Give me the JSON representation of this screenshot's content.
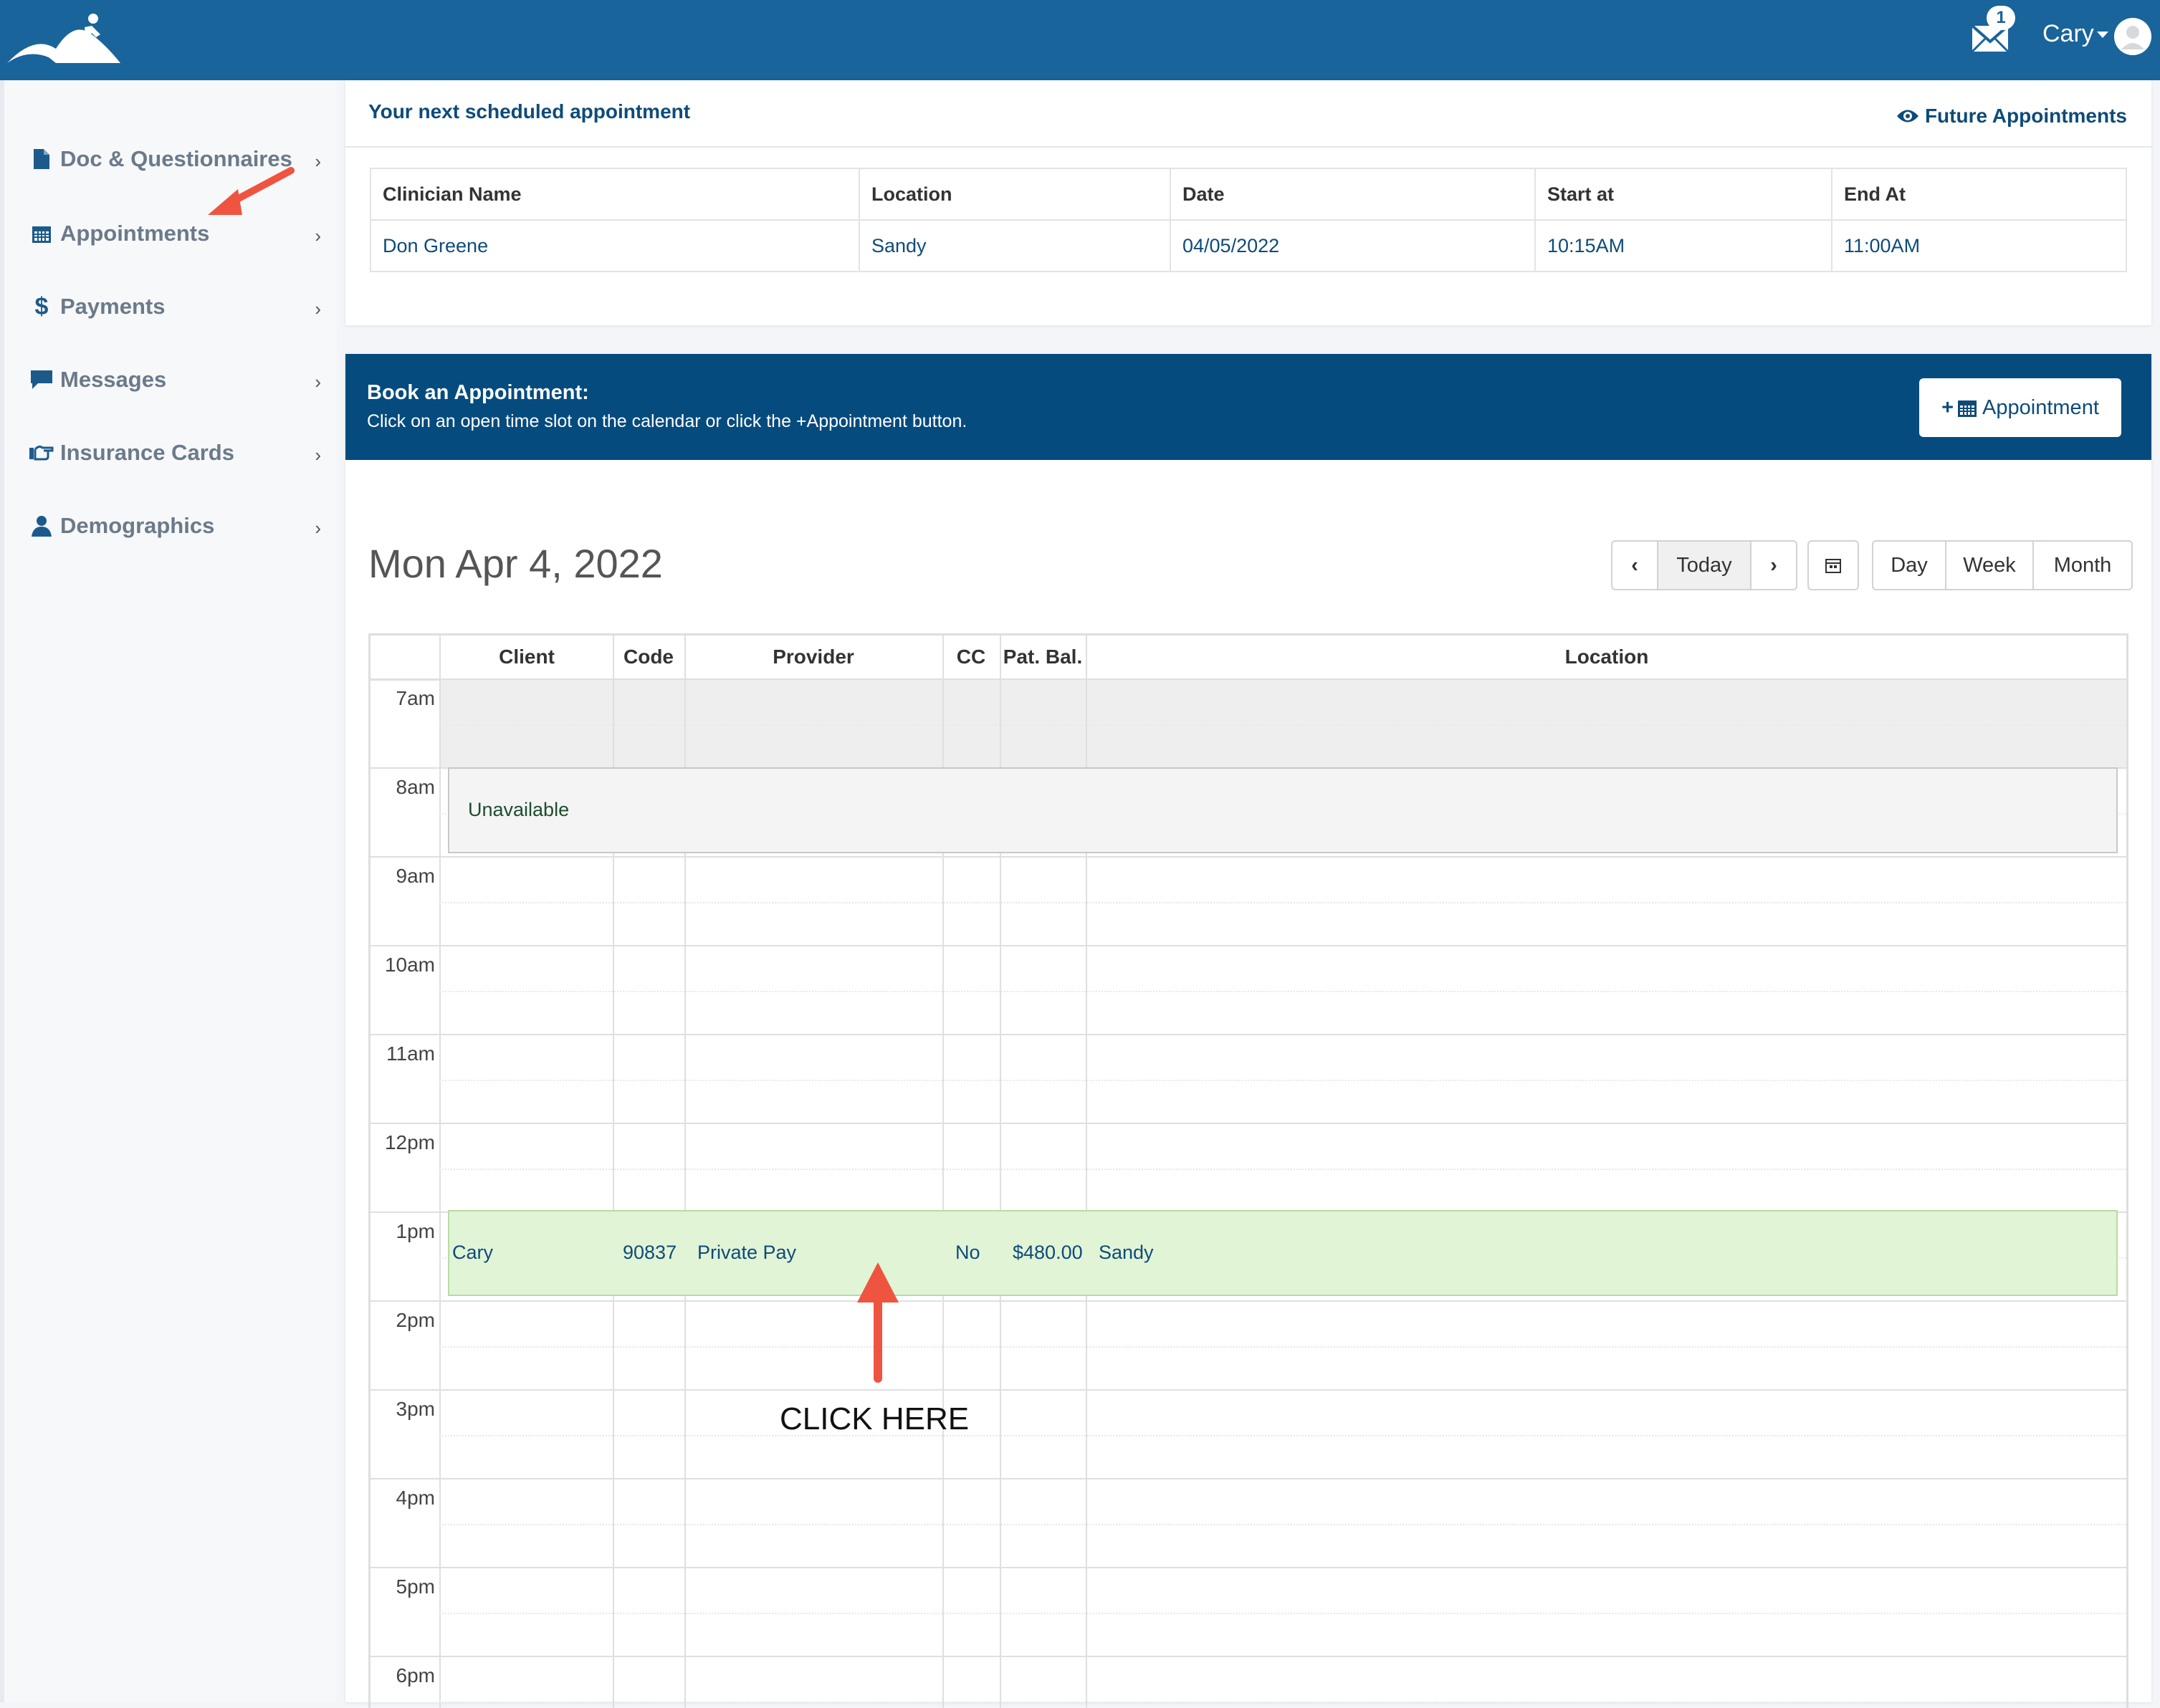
{
  "header": {
    "mail_badge": "1",
    "user_name": "Cary"
  },
  "sidebar": {
    "items": [
      {
        "label": "Doc & Questionnaires",
        "icon": "file-icon"
      },
      {
        "label": "Appointments",
        "icon": "calendar-icon"
      },
      {
        "label": "Payments",
        "icon": "dollar-icon"
      },
      {
        "label": "Messages",
        "icon": "comment-icon"
      },
      {
        "label": "Insurance Cards",
        "icon": "hand-point-icon"
      },
      {
        "label": "Demographics",
        "icon": "user-icon"
      }
    ]
  },
  "next_appointment": {
    "title": "Your next scheduled appointment",
    "future_link": "Future Appointments",
    "columns": [
      "Clinician Name",
      "Location",
      "Date",
      "Start at",
      "End At"
    ],
    "row": [
      "Don Greene",
      "Sandy",
      "04/05/2022",
      "10:15AM",
      "11:00AM"
    ]
  },
  "booking": {
    "title": "Book an Appointment:",
    "subtitle": "Click on an open time slot on the calendar or click the +Appointment button.",
    "add_button": "Appointment",
    "date_heading": "Mon Apr 4, 2022",
    "today_button": "Today",
    "views": [
      "Day",
      "Week",
      "Month"
    ]
  },
  "calendar": {
    "columns": [
      "Client",
      "Code",
      "Provider",
      "CC",
      "Pat. Bal.",
      "Location"
    ],
    "hours": [
      "7am",
      "8am",
      "9am",
      "10am",
      "11am",
      "12pm",
      "1pm",
      "2pm",
      "3pm",
      "4pm",
      "5pm",
      "6pm"
    ],
    "unavailable_label": "Unavailable",
    "event": {
      "client": "Cary",
      "code": "90837",
      "provider": "Private Pay",
      "cc": "No",
      "balance": "$480.00",
      "location": "Sandy"
    }
  },
  "annotation": {
    "click_here": "CLICK HERE"
  },
  "colors": {
    "topbar": "#19649a",
    "book_header": "#054b7e",
    "link": "#0e4b79",
    "event_bg": "#e1f4d6",
    "arrow": "#ef5440"
  }
}
